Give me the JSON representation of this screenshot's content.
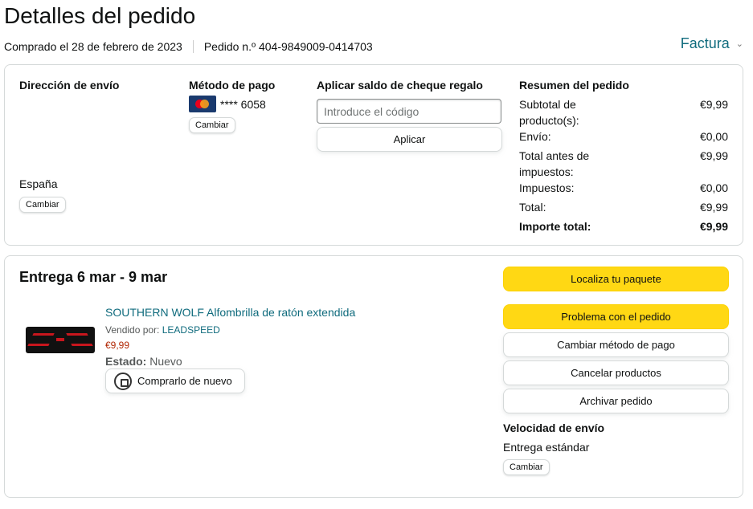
{
  "page": {
    "title": "Detalles del pedido",
    "purchased": "Comprado el 28 de febrero de 2023",
    "order_number": "Pedido n.º 404-9849009-0414703",
    "invoice": "Factura"
  },
  "shipping": {
    "header": "Dirección de envío",
    "country": "España",
    "change": "Cambiar"
  },
  "payment": {
    "header": "Método de pago",
    "card_digits": "**** 6058",
    "change": "Cambiar"
  },
  "gift": {
    "header": "Aplicar saldo de cheque regalo",
    "placeholder": "Introduce el código",
    "apply": "Aplicar"
  },
  "summary": {
    "header": "Resumen del pedido",
    "rows": [
      {
        "label": "Subtotal de producto(s):",
        "value": "€9,99"
      },
      {
        "label": "Envío:",
        "value": "€0,00"
      },
      {
        "label": "Total antes de impuestos:",
        "value": "€9,99"
      },
      {
        "label": "Impuestos:",
        "value": "€0,00"
      },
      {
        "label": "Total:",
        "value": "€9,99"
      },
      {
        "label": "Importe total:",
        "value": "€9,99"
      }
    ]
  },
  "delivery": {
    "title": "Entrega 6 mar - 9 mar",
    "product_name": "SOUTHERN WOLF Alfombrilla de ratón extendida",
    "sold_by_label": "Vendido por:",
    "seller": "LEADSPEED",
    "price": "€9,99",
    "condition_label": "Estado:",
    "condition": "Nuevo",
    "buy_again": "Comprarlo de nuevo"
  },
  "actions": {
    "track": "Localiza tu paquete",
    "problem": "Problema con el pedido",
    "change_payment": "Cambiar método de pago",
    "cancel": "Cancelar productos",
    "archive": "Archivar pedido"
  },
  "speed": {
    "title": "Velocidad de envío",
    "value": "Entrega estándar",
    "change": "Cambiar"
  },
  "colors": {
    "link": "#0f6b7d",
    "price": "#b12704",
    "primary_button": "#ffd814"
  }
}
